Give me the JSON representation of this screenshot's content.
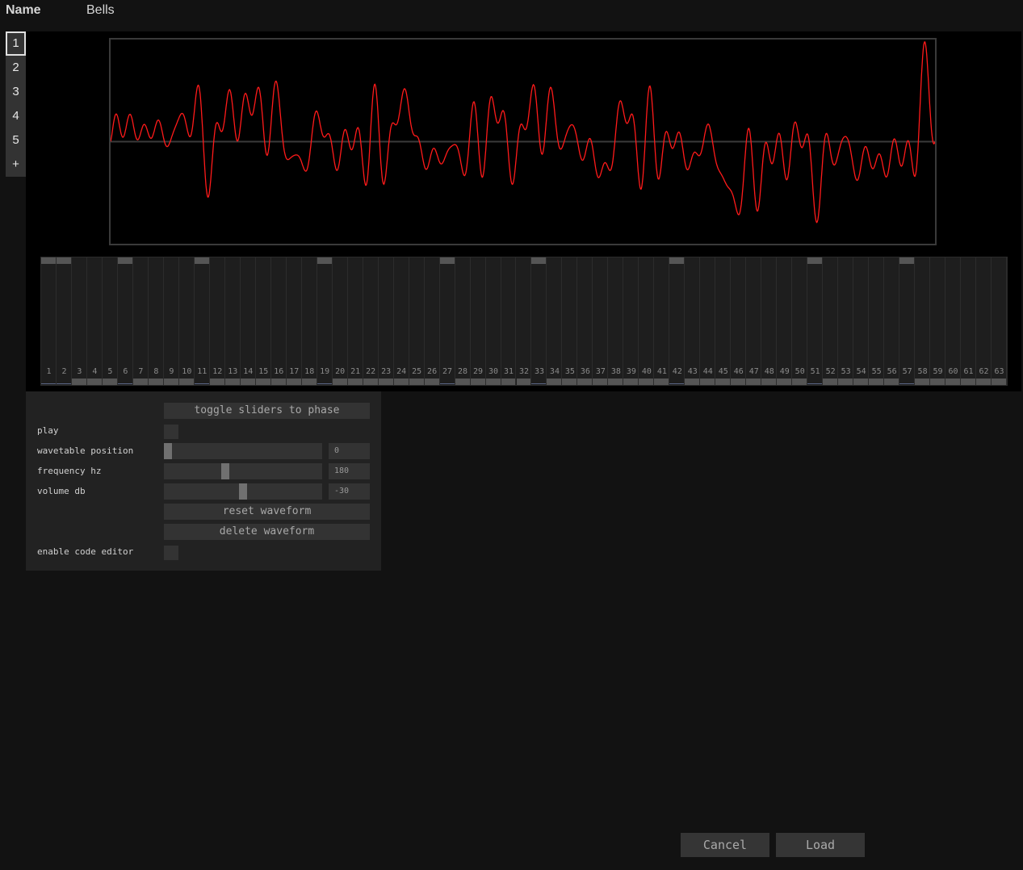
{
  "header": {
    "name_label": "Name",
    "name_value": "Bells"
  },
  "tabs": [
    {
      "label": "1",
      "active": true
    },
    {
      "label": "2",
      "active": false
    },
    {
      "label": "3",
      "active": false
    },
    {
      "label": "4",
      "active": false
    },
    {
      "label": "5",
      "active": false
    },
    {
      "label": "+",
      "active": false
    }
  ],
  "waveform": {
    "color": "#ff1a1a",
    "active_harmonics": [
      1,
      2,
      6,
      11,
      19,
      27,
      33,
      42,
      51,
      57
    ]
  },
  "harmonic_sliders": {
    "count": 63,
    "amplitudes": [
      1,
      1,
      0,
      0,
      0,
      1,
      0,
      0,
      0,
      0,
      1,
      0,
      0,
      0,
      0,
      0,
      0,
      0,
      1,
      0,
      0,
      0,
      0,
      0,
      0,
      0,
      1,
      0,
      0,
      0,
      0,
      0,
      1,
      0,
      0,
      0,
      0,
      0,
      0,
      0,
      0,
      1,
      0,
      0,
      0,
      0,
      0,
      0,
      0,
      0,
      1,
      0,
      0,
      0,
      0,
      0,
      1,
      0,
      0,
      0,
      0,
      0,
      0
    ]
  },
  "controls": {
    "toggle_phase_label": "toggle sliders to phase",
    "play_label": "play",
    "wavetable_position": {
      "label": "wavetable position",
      "value": "0",
      "fraction": 0.0
    },
    "frequency": {
      "label": "frequency hz",
      "value": "180",
      "fraction": 0.38
    },
    "volume": {
      "label": "volume db",
      "value": "-30",
      "fraction": 0.5
    },
    "reset_label": "reset waveform",
    "delete_label": "delete waveform",
    "code_editor_label": "enable code editor"
  },
  "footer": {
    "cancel_label": "Cancel",
    "load_label": "Load"
  }
}
